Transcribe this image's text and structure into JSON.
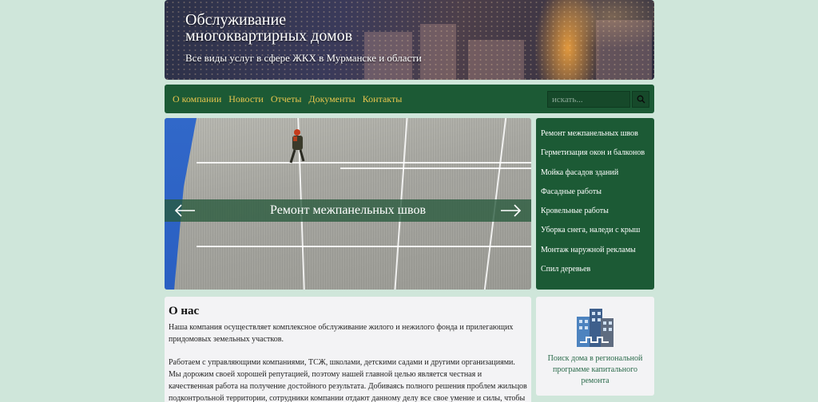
{
  "header": {
    "title": "Обслуживание\nмногоквартирных домов",
    "subtitle": "Все виды услуг в сфере ЖКХ в Мурманске и области"
  },
  "nav": {
    "items": [
      "О компании",
      "Новости",
      "Отчеты",
      "Документы",
      "Контакты"
    ],
    "search_placeholder": "искать..."
  },
  "slider": {
    "caption": "Ремонт межпанельных швов",
    "prev_icon": "arrow-left-icon",
    "next_icon": "arrow-right-icon"
  },
  "services": {
    "items": [
      "Ремонт межпанельных швов",
      "Герметизация окон и балконов",
      "Мойка фасадов зданий",
      "Фасадные работы",
      "Кровельные работы",
      "Уборка снега, наледи с крыш",
      "Монтаж наружной рекламы",
      "Спил деревьев"
    ]
  },
  "about": {
    "title": "О нас",
    "paragraphs": [
      "Наша компания осуществляет комплексное обслуживание жилого и нежилого фонда и прилегающих придомовых земельных участков.",
      "Работаем с управляющими компаниями, ТСЖ, школами, детскими садами и другими организациями. Мы дорожим своей хорошей репутацией, поэтому нашей главной целью является честная и качественная работа на получение достойного результата. Добиваясь полного решения проблем жильцов подконтрольной территории, сотрудники компании отдают данному делу все свое умение и силы, чтобы репутация"
    ]
  },
  "widget": {
    "icon": "buildings-icon",
    "link": "Поиск дома в региональной программе капитального ремонта"
  },
  "colors": {
    "background": "#cfe6da",
    "green": "#1c5a35",
    "nav_text": "#e8c64e"
  }
}
